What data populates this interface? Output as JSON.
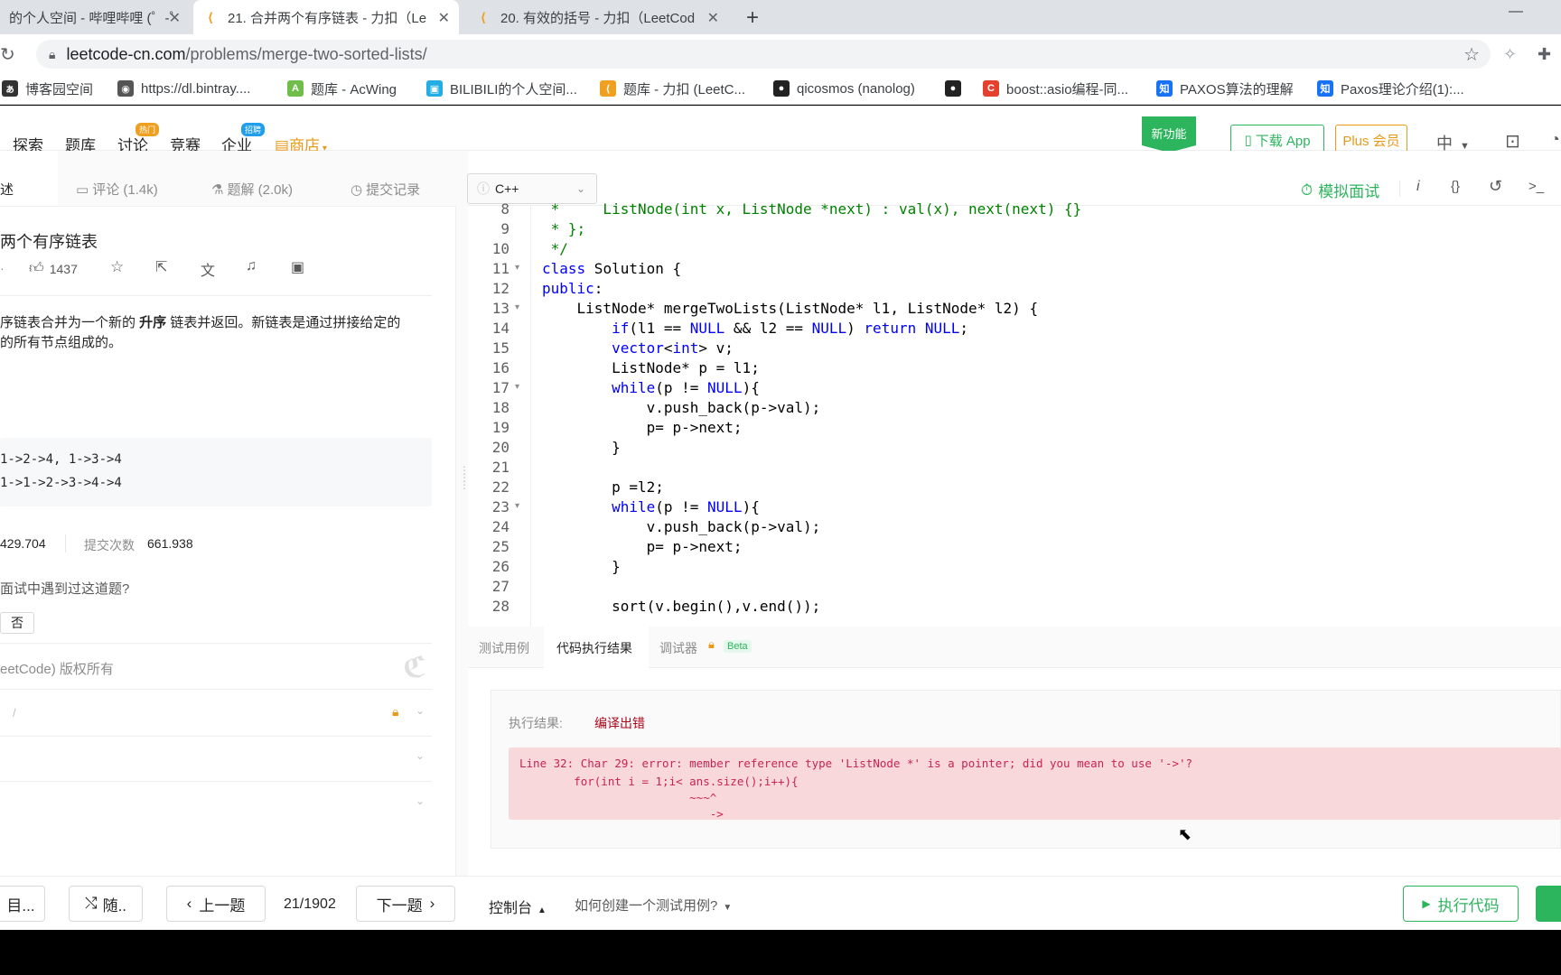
{
  "browser": {
    "tabs": [
      {
        "label": "的个人空间 - 哔哩哔哩 (゜-゜",
        "active": false
      },
      {
        "label": "21. 合并两个有序链表 - 力扣（Le",
        "active": true
      },
      {
        "label": "20. 有效的括号 - 力扣（LeetCod",
        "active": false
      }
    ],
    "new_tab": "+",
    "minimize": "—",
    "url_host": "leetcode-cn.com",
    "url_path": "/problems/merge-two-sorted-lists/",
    "bookmarks": [
      {
        "label": "博客园空间",
        "icon": "cnblogs-icon",
        "color": "#333333"
      },
      {
        "label": "https://dl.bintray....",
        "icon": "globe-icon",
        "color": "#555555"
      },
      {
        "label": "题库 - AcWing",
        "icon": "acwing-icon",
        "color": "#6fbe4a"
      },
      {
        "label": "BILIBILI的个人空间...",
        "icon": "bilibili-icon",
        "color": "#23ade5"
      },
      {
        "label": "题库 - 力扣 (LeetC...",
        "icon": "leetcode-icon",
        "color": "#f0a020"
      },
      {
        "label": "qicosmos (nanolog)",
        "icon": "github-icon",
        "color": "#222222"
      },
      {
        "label": "",
        "icon": "github-icon",
        "color": "#222222"
      },
      {
        "label": "boost::asio编程-同...",
        "icon": "csdn-icon",
        "color": "#e53f2e"
      },
      {
        "label": "PAXOS算法的理解",
        "icon": "zhihu-icon",
        "color": "#1772f6"
      },
      {
        "label": "Paxos理论介绍(1):...",
        "icon": "zhihu-icon",
        "color": "#1772f6"
      }
    ]
  },
  "nav": {
    "items": [
      "探索",
      "题库",
      "讨论",
      "竞赛",
      "企业"
    ],
    "hot_badge": "热门",
    "hiring_badge": "招聘",
    "shop": "商店",
    "new_feature": "新功能",
    "download_app": "下载 App",
    "plus": "Plus 会员",
    "lang": "中"
  },
  "left": {
    "tabs": {
      "desc": "述",
      "comments": "评论 (1.4k)",
      "solutions": "题解 (2.0k)",
      "submissions": "提交记录"
    },
    "title": "两个有序链表",
    "likes": "1437",
    "desc_line1_a": "序链表合并为一个新的 ",
    "desc_line1_b": "升序",
    "desc_line1_c": " 链表并返回。新链表是通过拼接给定的",
    "desc_line2": "的所有节点组成的。",
    "example_in": "1->2->4, 1->3->4",
    "example_out": "1->1->2->3->4->4",
    "accepted": "429.704",
    "submit_label": "提交次数",
    "submit_count": "661.938",
    "interview_q": "面试中遇到过这道题?",
    "no_btn": "否",
    "copyright": "eetCode) 版权所有"
  },
  "editor": {
    "language": "C++",
    "mock_interview": "模拟面试",
    "lines": [
      {
        "n": "8",
        "fold": false
      },
      {
        "n": "9",
        "fold": false
      },
      {
        "n": "10",
        "fold": false
      },
      {
        "n": "11",
        "fold": true
      },
      {
        "n": "12",
        "fold": false
      },
      {
        "n": "13",
        "fold": true
      },
      {
        "n": "14",
        "fold": false
      },
      {
        "n": "15",
        "fold": false
      },
      {
        "n": "16",
        "fold": false
      },
      {
        "n": "17",
        "fold": true
      },
      {
        "n": "18",
        "fold": false
      },
      {
        "n": "19",
        "fold": false
      },
      {
        "n": "20",
        "fold": false
      },
      {
        "n": "21",
        "fold": false
      },
      {
        "n": "22",
        "fold": false
      },
      {
        "n": "23",
        "fold": true
      },
      {
        "n": "24",
        "fold": false
      },
      {
        "n": "25",
        "fold": false
      },
      {
        "n": "26",
        "fold": false
      },
      {
        "n": "27",
        "fold": false
      },
      {
        "n": "28",
        "fold": false
      }
    ],
    "code": [
      " *     ListNode(int x, ListNode *next) : val(x), next(next) {}",
      " * };",
      " */",
      "class Solution {",
      "public:",
      "    ListNode* mergeTwoLists(ListNode* l1, ListNode* l2) {",
      "        if(l1 == NULL && l2 == NULL) return NULL;",
      "        vector<int> v;",
      "        ListNode* p = l1;",
      "        while(p != NULL){",
      "            v.push_back(p->val);",
      "            p= p->next;",
      "        }",
      "",
      "        p =l2;",
      "        while(p != NULL){",
      "            v.push_back(p->val);",
      "            p= p->next;",
      "        }",
      "",
      "        sort(v.begin(),v.end());"
    ]
  },
  "console": {
    "tabs": [
      "测试用例",
      "代码执行结果",
      "调试器"
    ],
    "beta": "Beta",
    "result_label": "执行结果:",
    "result_value": "编译出错",
    "error_line1": "Line 32: Char 29: error: member reference type 'ListNode *' is a pointer; did you mean to use '->'?",
    "error_line2": "        for(int i = 1;i< ans.size();i++){",
    "error_line3": "                         ~~~^",
    "error_line4": "                            ->"
  },
  "footer": {
    "list": "目...",
    "random": "随..",
    "prev": "上一题",
    "counter": "21/1902",
    "next": "下一题",
    "console": "控制台",
    "how_test": "如何创建一个测试用例?",
    "run": "执行代码"
  },
  "colors": {
    "accent_green": "#2db55d",
    "error_red": "#c7254e",
    "error_bg": "#f9d8dc",
    "shop_orange": "#e89a1b"
  }
}
